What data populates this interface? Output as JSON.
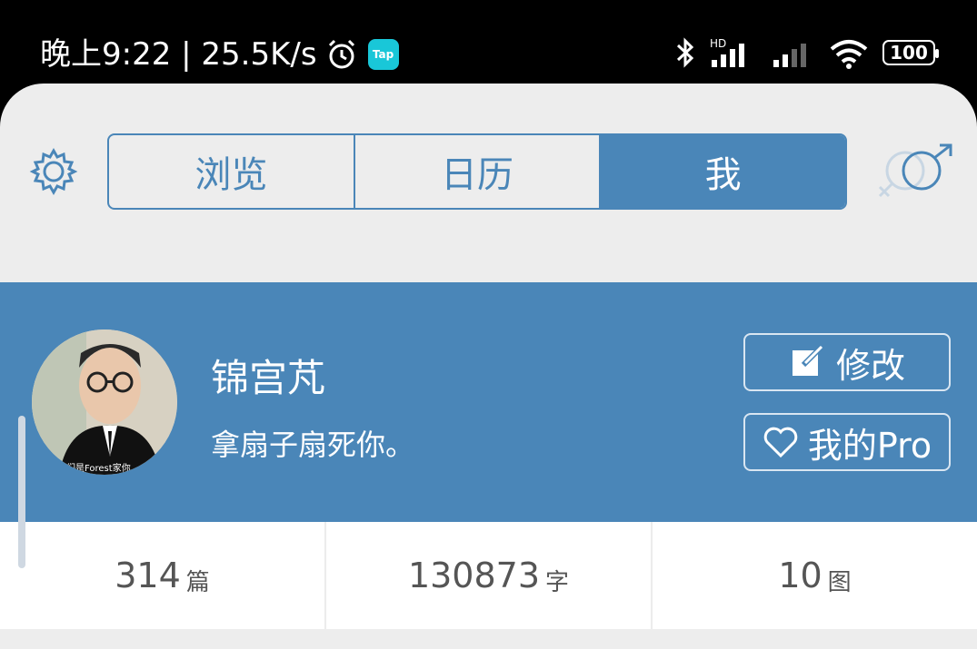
{
  "status_bar": {
    "time_speed": "晚上9:22 | 25.5K/s",
    "tap_badge": "Tap",
    "battery": "100"
  },
  "nav": {
    "tabs": [
      {
        "label": "浏览"
      },
      {
        "label": "日历"
      },
      {
        "label": "我",
        "active": true
      }
    ]
  },
  "profile": {
    "username": "锦宫芃",
    "bio": "拿扇子扇死你。",
    "avatar_caption": "我们是Forest家你",
    "edit_label": "修改",
    "pro_label": "我的Pro"
  },
  "stats": [
    {
      "value": "314",
      "unit": "篇"
    },
    {
      "value": "130873",
      "unit": "字"
    },
    {
      "value": "10",
      "unit": "图"
    }
  ],
  "colors": {
    "accent": "#4a86b8",
    "status_bar_bg": "#000000",
    "page_bg": "#ededed"
  },
  "icons": {
    "settings": "gear-icon",
    "gender": "gender-icon",
    "edit": "edit-icon",
    "pro": "heart-icon"
  }
}
